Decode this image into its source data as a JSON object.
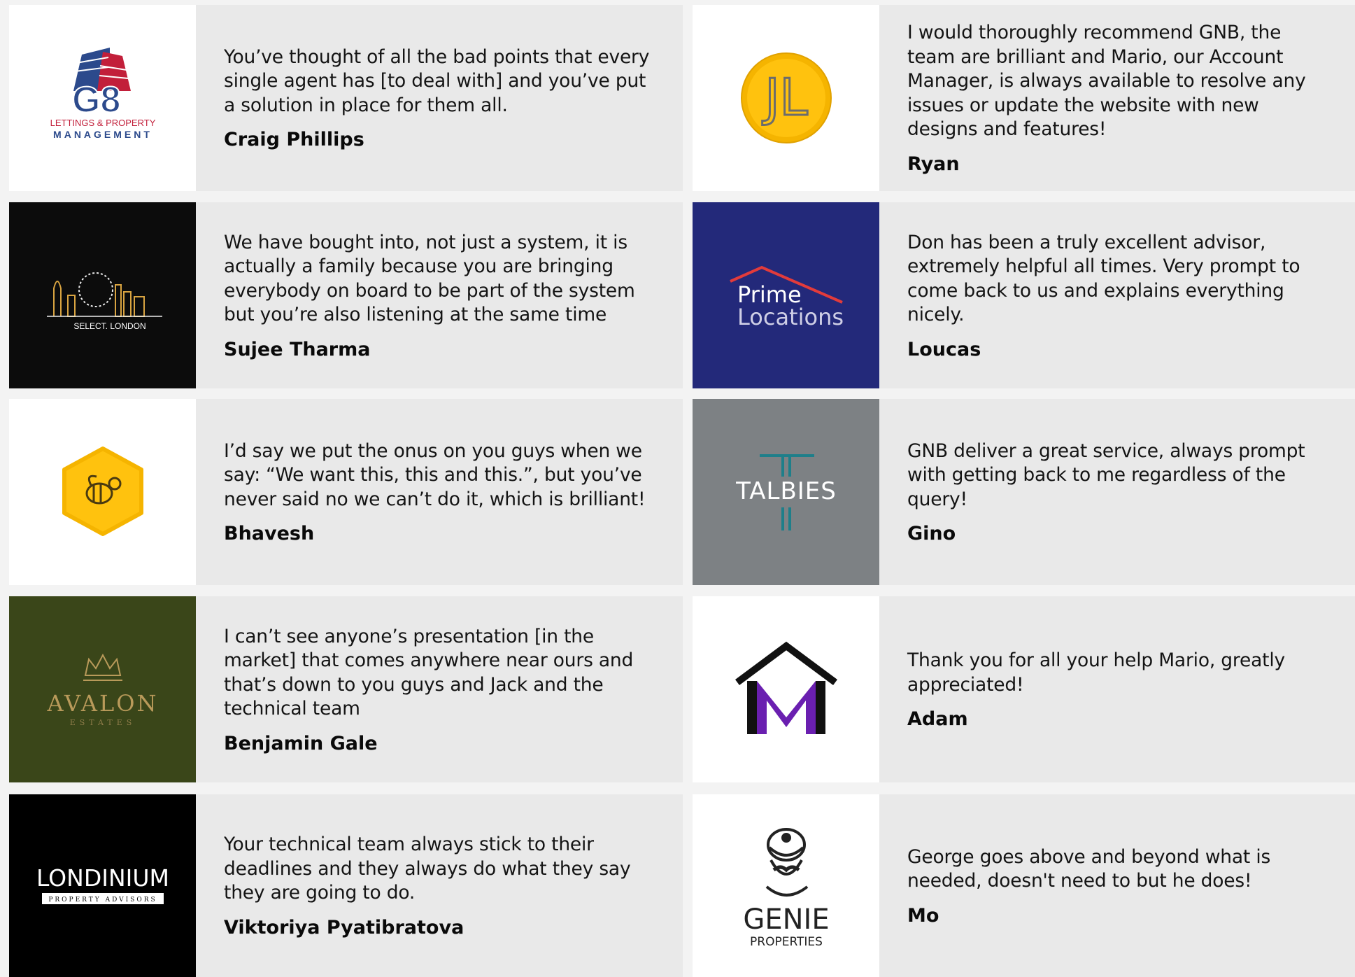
{
  "testimonials": [
    {
      "logo": {
        "name": "g8-logo",
        "lines": [
          "G8",
          "LETTINGS & PROPERTY",
          "MANAGEMENT"
        ],
        "bg": "#ffffff"
      },
      "quote": "You’ve thought of all the bad points that every single agent has [to deal with] and you’ve put a solution in place for them all.",
      "author": "Craig Phillips"
    },
    {
      "logo": {
        "name": "jl-logo",
        "lines": [
          "JL"
        ],
        "bg": "#ffffff"
      },
      "quote": "I would thoroughly recommend GNB, the team are brilliant and Mario, our Account Manager, is always available to resolve any issues or update the website with new designs and features!",
      "author": "Ryan"
    },
    {
      "logo": {
        "name": "select-london-logo",
        "lines": [
          "SELECT. LONDON"
        ],
        "bg": "#0c0c0c"
      },
      "quote": "We have bought into, not just a system, it is actually a family because you are bringing everybody on board to be part of the system but you’re also listening at the same time",
      "author": "Sujee Tharma"
    },
    {
      "logo": {
        "name": "prime-locations-logo",
        "lines": [
          "Prime",
          "Locations"
        ],
        "bg": "#23297a"
      },
      "quote": "Don has been a truly excellent advisor, extremely helpful all times. Very prompt to come back to us and explains everything nicely.",
      "author": "Loucas"
    },
    {
      "logo": {
        "name": "bee-logo",
        "lines": [],
        "bg": "#ffffff"
      },
      "quote": "I’d say we put the onus on you guys when we say: “We want this, this and this.”, but you’ve never said no we can’t do it, which is brilliant!",
      "author": "Bhavesh"
    },
    {
      "logo": {
        "name": "talbies-logo",
        "lines": [
          "TALBIES"
        ],
        "bg": "#7d8184"
      },
      "quote": "GNB deliver a great service, always prompt with getting back to me regardless of the query!",
      "author": "Gino"
    },
    {
      "logo": {
        "name": "avalon-logo",
        "lines": [
          "AVALON",
          "ESTATES"
        ],
        "bg": "#3a4619"
      },
      "quote": "I can’t see anyone’s presentation [in the market] that comes anywhere near ours and that’s down to you guys and Jack and the technical team",
      "author": "Benjamin Gale"
    },
    {
      "logo": {
        "name": "house-m-logo",
        "lines": [],
        "bg": "#ffffff"
      },
      "quote": "Thank you for all your help Mario, greatly appreciated!",
      "author": "Adam"
    },
    {
      "logo": {
        "name": "londinium-logo",
        "lines": [
          "LONDINIUM",
          "PROPERTY ADVISORS"
        ],
        "bg": "#000000"
      },
      "quote": "Your technical team always stick to their deadlines and they always do what they say they are going to do.",
      "author": "Viktoriya Pyatibratova"
    },
    {
      "logo": {
        "name": "genie-logo",
        "lines": [
          "GENIE",
          "PROPERTIES"
        ],
        "bg": "#ffffff"
      },
      "quote": "George goes above and beyond what is needed, doesn't need to but he does!",
      "author": "Mo"
    }
  ]
}
